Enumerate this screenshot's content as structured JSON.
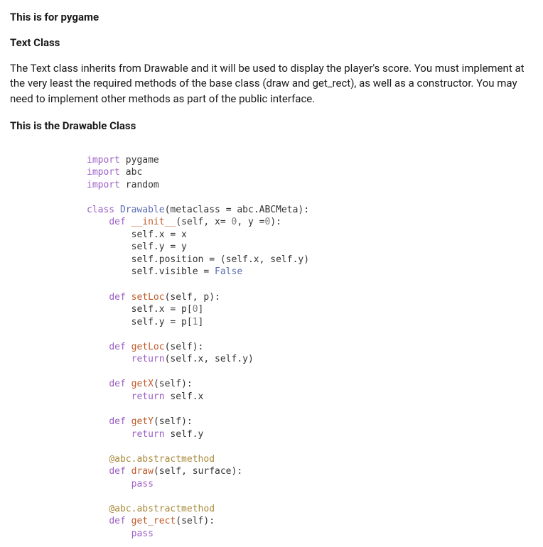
{
  "header1": "This is for pygame",
  "header2": "Text Class",
  "paragraph": "The Text class inherits from Drawable and it will be used to display the player's score. You must implement at the very least the required methods of the base class (draw and get_rect), as well as a constructor. You may need to implement other methods as part of the public interface.",
  "header3": "This is the Drawable Class",
  "code": {
    "lines": [
      [
        [
          "kw",
          "import"
        ],
        [
          "txt",
          " pygame"
        ]
      ],
      [
        [
          "kw",
          "import"
        ],
        [
          "txt",
          " abc"
        ]
      ],
      [
        [
          "kw",
          "import"
        ],
        [
          "txt",
          " random"
        ]
      ],
      [
        [
          "txt",
          ""
        ]
      ],
      [
        [
          "kw",
          "class"
        ],
        [
          "txt",
          " "
        ],
        [
          "cls",
          "Drawable"
        ],
        [
          "txt",
          "(metaclass "
        ],
        [
          "op",
          "="
        ],
        [
          "txt",
          " abc.ABCMeta):"
        ]
      ],
      [
        [
          "txt",
          "    "
        ],
        [
          "kw",
          "def"
        ],
        [
          "txt",
          " "
        ],
        [
          "fn",
          "__init__"
        ],
        [
          "txt",
          "(self, x"
        ],
        [
          "op",
          "="
        ],
        [
          "txt",
          " "
        ],
        [
          "num",
          "0"
        ],
        [
          "txt",
          ", y "
        ],
        [
          "op",
          "="
        ],
        [
          "num",
          "0"
        ],
        [
          "txt",
          "):"
        ]
      ],
      [
        [
          "txt",
          "        self.x "
        ],
        [
          "op",
          "="
        ],
        [
          "txt",
          " x"
        ]
      ],
      [
        [
          "txt",
          "        self.y "
        ],
        [
          "op",
          "="
        ],
        [
          "txt",
          " y"
        ]
      ],
      [
        [
          "txt",
          "        self.position "
        ],
        [
          "op",
          "="
        ],
        [
          "txt",
          " (self.x, self.y)"
        ]
      ],
      [
        [
          "txt",
          "        self.visible "
        ],
        [
          "op",
          "="
        ],
        [
          "txt",
          " "
        ],
        [
          "bool",
          "False"
        ]
      ],
      [
        [
          "txt",
          ""
        ]
      ],
      [
        [
          "txt",
          "    "
        ],
        [
          "kw",
          "def"
        ],
        [
          "txt",
          " "
        ],
        [
          "fn",
          "setLoc"
        ],
        [
          "txt",
          "(self, p):"
        ]
      ],
      [
        [
          "txt",
          "        self.x "
        ],
        [
          "op",
          "="
        ],
        [
          "txt",
          " p["
        ],
        [
          "num",
          "0"
        ],
        [
          "txt",
          "]"
        ]
      ],
      [
        [
          "txt",
          "        self.y "
        ],
        [
          "op",
          "="
        ],
        [
          "txt",
          " p["
        ],
        [
          "num",
          "1"
        ],
        [
          "txt",
          "]"
        ]
      ],
      [
        [
          "txt",
          ""
        ]
      ],
      [
        [
          "txt",
          "    "
        ],
        [
          "kw",
          "def"
        ],
        [
          "txt",
          " "
        ],
        [
          "fn",
          "getLoc"
        ],
        [
          "txt",
          "(self):"
        ]
      ],
      [
        [
          "txt",
          "        "
        ],
        [
          "kw",
          "return"
        ],
        [
          "txt",
          "(self.x, self.y)"
        ]
      ],
      [
        [
          "txt",
          ""
        ]
      ],
      [
        [
          "txt",
          "    "
        ],
        [
          "kw",
          "def"
        ],
        [
          "txt",
          " "
        ],
        [
          "fn",
          "getX"
        ],
        [
          "txt",
          "(self):"
        ]
      ],
      [
        [
          "txt",
          "        "
        ],
        [
          "kw",
          "return"
        ],
        [
          "txt",
          " self.x"
        ]
      ],
      [
        [
          "txt",
          ""
        ]
      ],
      [
        [
          "txt",
          "    "
        ],
        [
          "kw",
          "def"
        ],
        [
          "txt",
          " "
        ],
        [
          "fn",
          "getY"
        ],
        [
          "txt",
          "(self):"
        ]
      ],
      [
        [
          "txt",
          "        "
        ],
        [
          "kw",
          "return"
        ],
        [
          "txt",
          " self.y"
        ]
      ],
      [
        [
          "txt",
          ""
        ]
      ],
      [
        [
          "txt",
          "    "
        ],
        [
          "dec",
          "@abc.abstractmethod"
        ]
      ],
      [
        [
          "txt",
          "    "
        ],
        [
          "kw",
          "def"
        ],
        [
          "txt",
          " "
        ],
        [
          "fn",
          "draw"
        ],
        [
          "txt",
          "(self, surface):"
        ]
      ],
      [
        [
          "txt",
          "        "
        ],
        [
          "kw",
          "pass"
        ]
      ],
      [
        [
          "txt",
          ""
        ]
      ],
      [
        [
          "txt",
          "    "
        ],
        [
          "dec",
          "@abc.abstractmethod"
        ]
      ],
      [
        [
          "txt",
          "    "
        ],
        [
          "kw",
          "def"
        ],
        [
          "txt",
          " "
        ],
        [
          "fn",
          "get_rect"
        ],
        [
          "txt",
          "(self):"
        ]
      ],
      [
        [
          "txt",
          "        "
        ],
        [
          "kw",
          "pass"
        ]
      ]
    ]
  }
}
